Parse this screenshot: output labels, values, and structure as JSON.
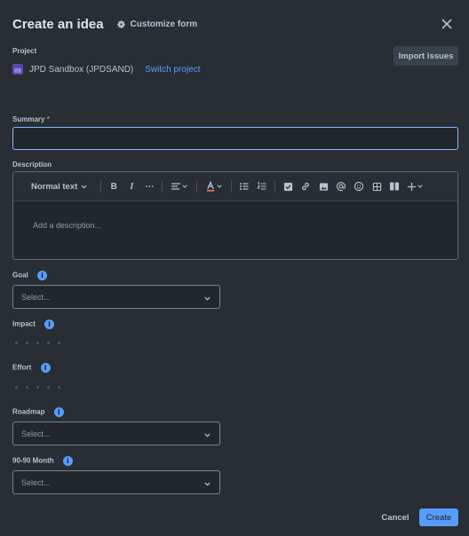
{
  "header": {
    "title": "Create an idea",
    "customize_label": "Customize form"
  },
  "project": {
    "label": "Project",
    "name": "JPD Sandbox (JPDSAND)",
    "switch_label": "Switch project",
    "import_label": "Import issues"
  },
  "summary": {
    "label": "Summary",
    "required_mark": "*",
    "value": ""
  },
  "description": {
    "label": "Description",
    "text_style": "Normal text",
    "bold": "B",
    "italic": "I",
    "more": "⋯",
    "placeholder": "Add a description..."
  },
  "goal": {
    "label": "Goal",
    "placeholder": "Select..."
  },
  "impact": {
    "label": "Impact",
    "rating": 0,
    "max": 5
  },
  "effort": {
    "label": "Effort",
    "rating": 0,
    "max": 5
  },
  "roadmap": {
    "label": "Roadmap",
    "placeholder": "Select..."
  },
  "month": {
    "label": "90-90 Month",
    "placeholder": "Select..."
  },
  "footer": {
    "cancel_label": "Cancel",
    "create_label": "Create"
  },
  "colors": {
    "background": "#282e33",
    "accent": "#579dff",
    "focus_border": "#85b8ff",
    "required": "#f87168"
  },
  "icons": [
    "gear-icon",
    "close-icon",
    "info-icon",
    "chevron-down-icon"
  ]
}
